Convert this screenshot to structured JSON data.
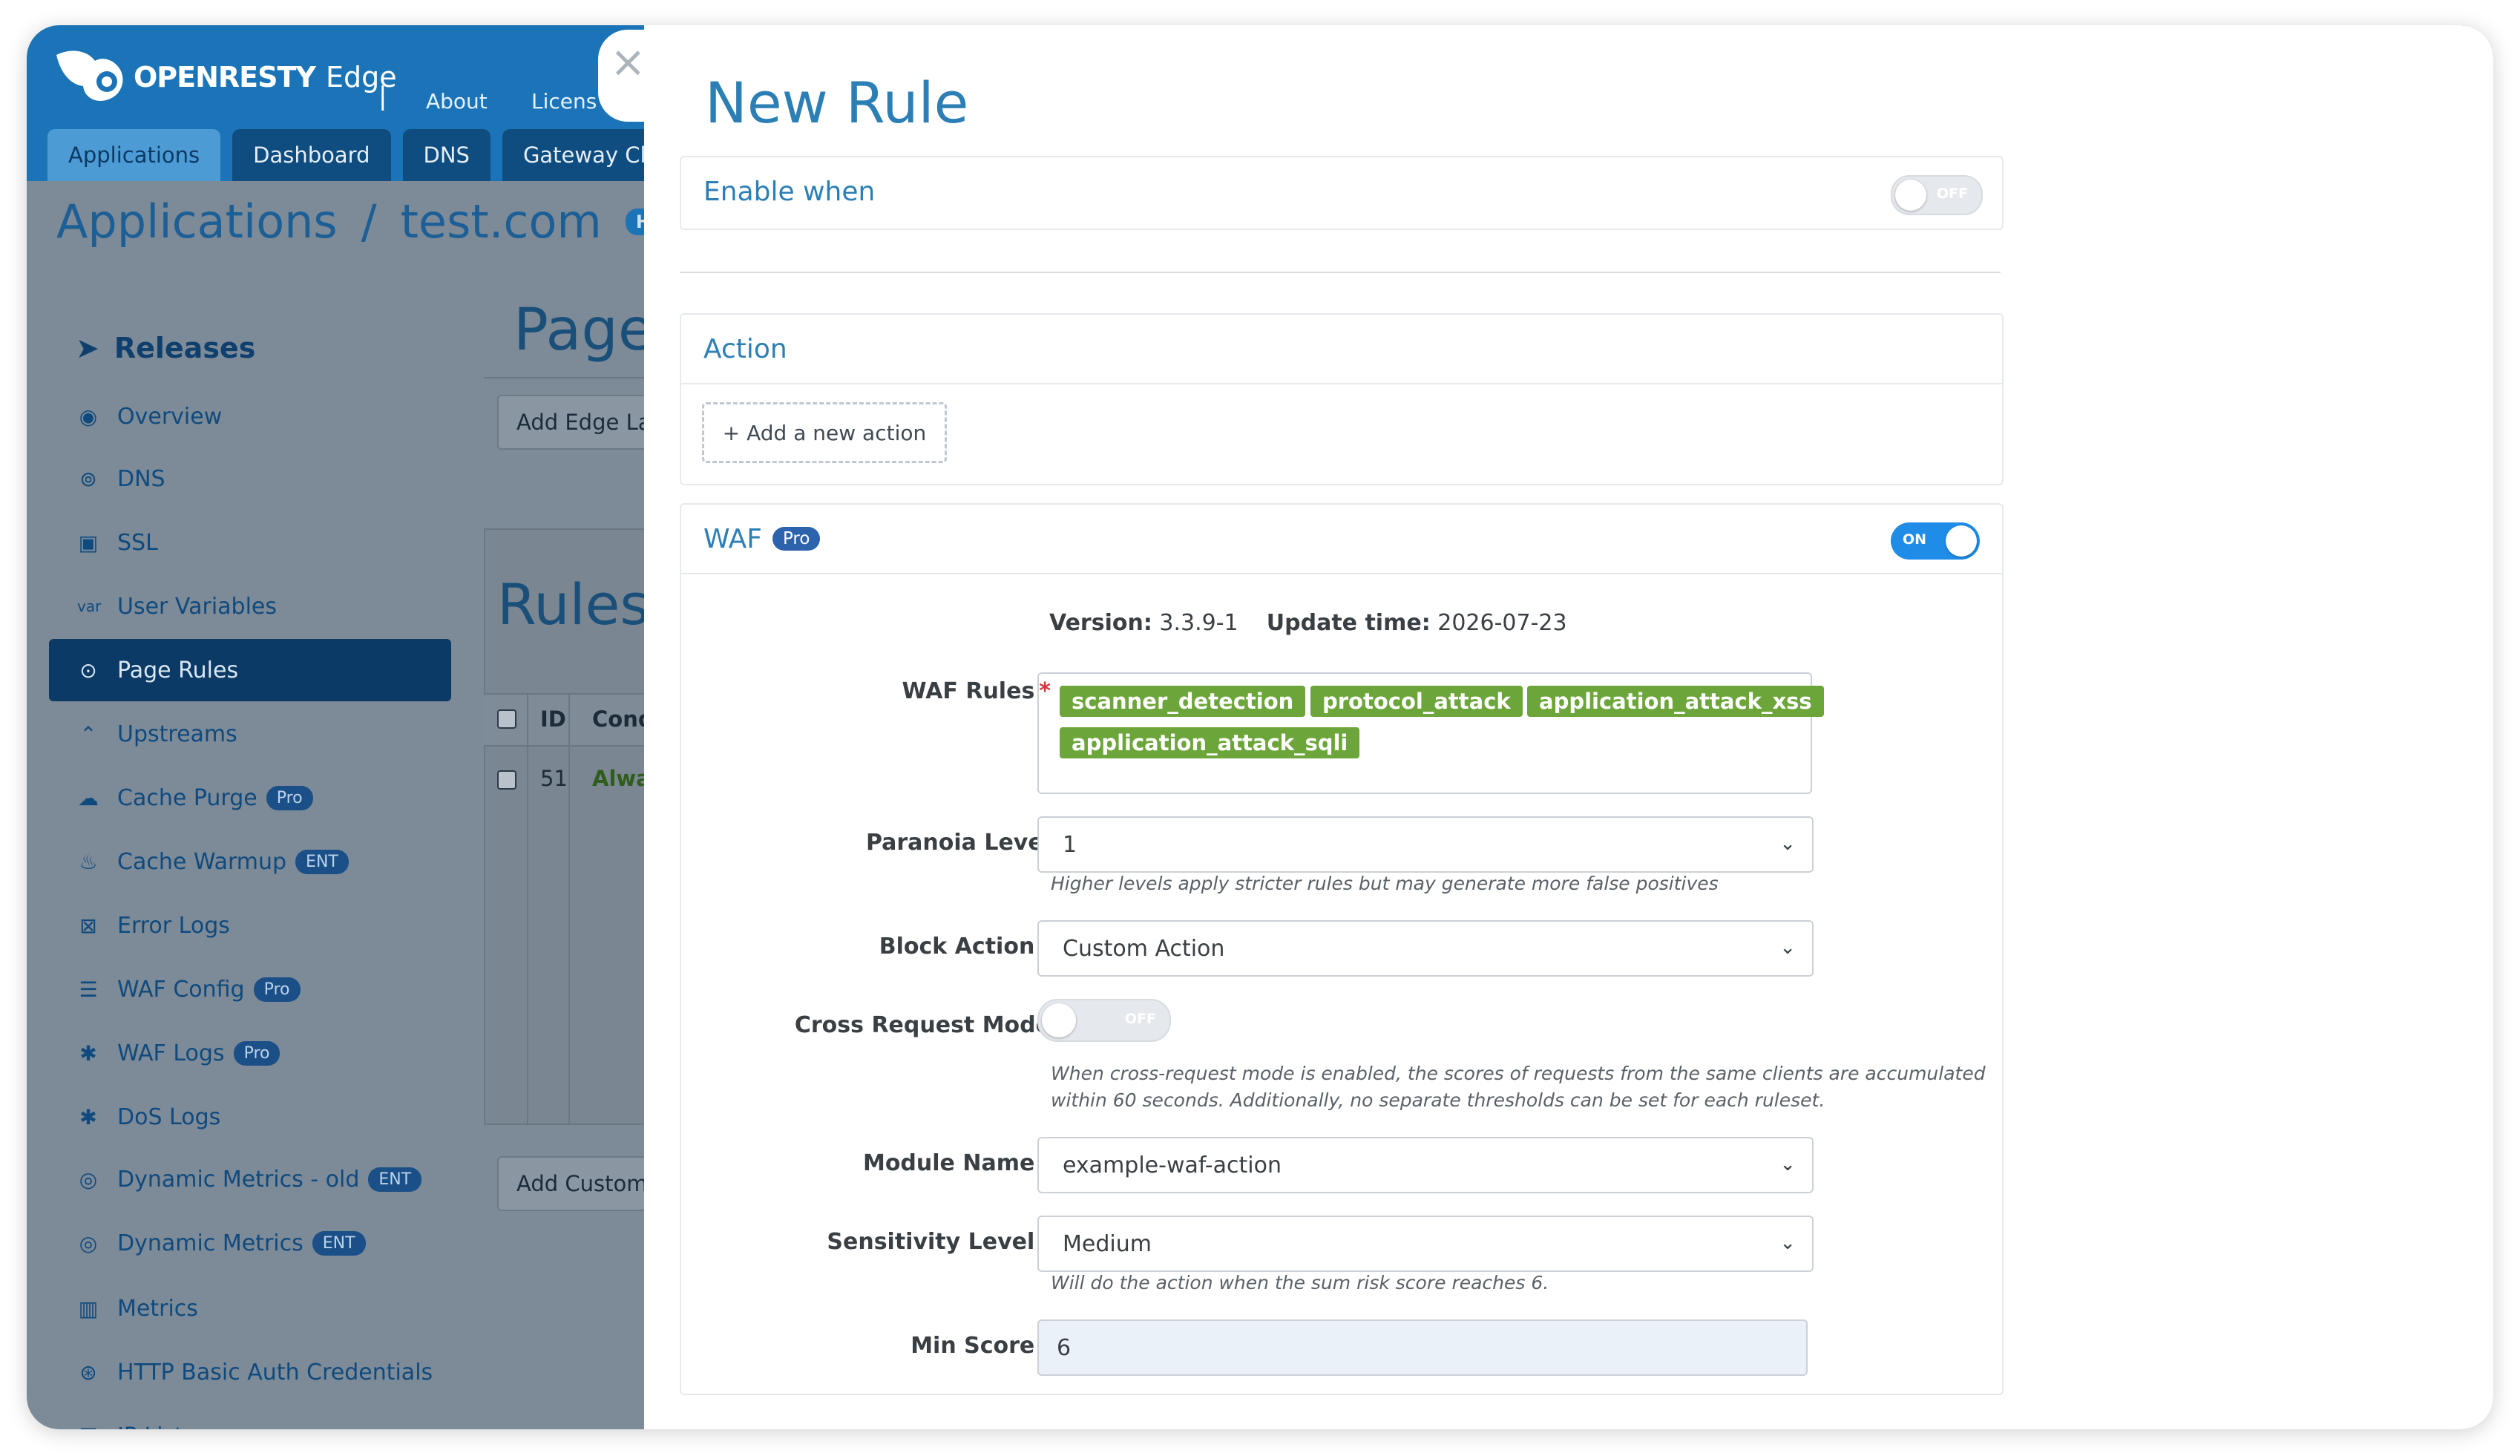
{
  "app": {
    "brand": "OPENRESTY",
    "product": "Edge",
    "separator": "|",
    "top_links": [
      "About",
      "Licens"
    ],
    "tabs": [
      "Applications",
      "Dashboard",
      "DNS",
      "Gateway Cl"
    ],
    "breadcrumb": {
      "root": "Applications",
      "sep": "/",
      "current": "test.com",
      "badge": "HTT"
    },
    "sidebar": {
      "title": "Releases",
      "items": [
        {
          "label": "Overview",
          "icon": "dashboard-icon"
        },
        {
          "label": "DNS",
          "icon": "dns-icon"
        },
        {
          "label": "SSL",
          "icon": "ssl-icon"
        },
        {
          "label": "User Variables",
          "icon": "var-icon"
        },
        {
          "label": "Page Rules",
          "icon": "rules-icon",
          "active": true
        },
        {
          "label": "Upstreams",
          "icon": "upstream-icon"
        },
        {
          "label": "Cache Purge",
          "icon": "purge-icon",
          "badge": "Pro"
        },
        {
          "label": "Cache Warmup",
          "icon": "flame-icon",
          "badge": "ENT"
        },
        {
          "label": "Error Logs",
          "icon": "error-log-icon"
        },
        {
          "label": "WAF Config",
          "icon": "waf-config-icon",
          "badge": "Pro"
        },
        {
          "label": "WAF Logs",
          "icon": "waf-log-icon",
          "badge": "Pro"
        },
        {
          "label": "DoS Logs",
          "icon": "dos-log-icon"
        },
        {
          "label": "Dynamic Metrics - old",
          "icon": "metrics-old-icon",
          "badge": "ENT"
        },
        {
          "label": "Dynamic Metrics",
          "icon": "dynamic-metrics-icon",
          "badge": "ENT"
        },
        {
          "label": "Metrics",
          "icon": "bar-chart-icon"
        },
        {
          "label": "HTTP Basic Auth Credentials",
          "icon": "auth-icon"
        },
        {
          "label": "IP Lists",
          "icon": "list-icon"
        }
      ]
    },
    "main": {
      "title": "Page",
      "add_edge_btn": "Add Edge La",
      "rules_title": "Rules",
      "table_headers": [
        "ID",
        "Cond"
      ],
      "row": {
        "id": "51",
        "cond": "Alwa"
      },
      "add_custom_btn": "Add Custom"
    }
  },
  "modal": {
    "close": "×",
    "title": "New Rule",
    "enable_when": {
      "label": "Enable when",
      "toggle": "OFF"
    },
    "action": {
      "label": "Action",
      "add_button": "+ Add a new action"
    },
    "waf": {
      "label": "WAF",
      "badge": "Pro",
      "toggle": "ON",
      "version_label": "Version:",
      "version": "3.3.9-1",
      "update_label": "Update time:",
      "update_time": "2026-07-23",
      "rules_label": "WAF Rules",
      "rules": [
        "scanner_detection",
        "protocol_attack",
        "application_attack_xss",
        "application_attack_sqli"
      ],
      "paranoia_label": "Paranoia Level",
      "paranoia_value": "1",
      "paranoia_help": "Higher levels apply stricter rules but may generate more false positives",
      "block_action_label": "Block Action",
      "block_action_value": "Custom Action",
      "cross_request_label": "Cross Request Mode",
      "cross_request_toggle": "OFF",
      "cross_request_help_1": "When cross-request mode is enabled, the scores of requests from the same clients are accumulated",
      "cross_request_help_2": "within 60 seconds. Additionally, no separate thresholds can be set for each ruleset.",
      "module_label": "Module Name",
      "module_value": "example-waf-action",
      "sensitivity_label": "Sensitivity Level",
      "sensitivity_value": "Medium",
      "sensitivity_help": "Will do the action when the sum risk score reaches 6.",
      "min_score_label": "Min Score",
      "min_score_value": "6"
    }
  },
  "colors": {
    "header": "#1c74b8",
    "accent": "#2b7fb5",
    "tag": "#6ca63a",
    "toggle_on": "#1f8ce8",
    "required": "#d8323c"
  }
}
